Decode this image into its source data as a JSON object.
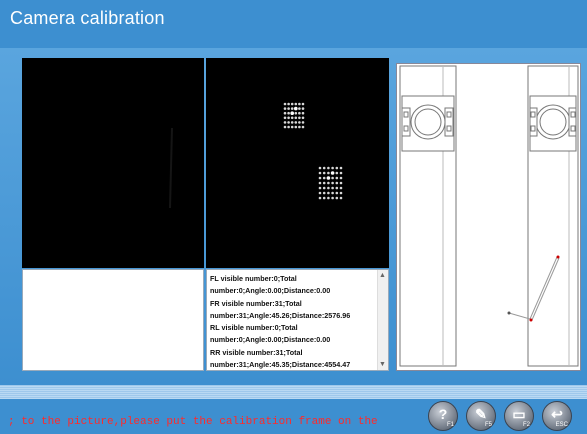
{
  "window": {
    "title": "Camera calibration"
  },
  "info": {
    "lines": [
      "FL visible number:0;Total",
      "number:0;Angle:0.00;Distance:0.00",
      "FR visible number:31;Total",
      "number:31;Angle:45.26;Distance:2576.96",
      "RL visible number:0;Total",
      "number:0;Angle:0.00;Distance:0.00",
      "RR visible number:31;Total",
      "number:31;Angle:45.35;Distance:4554.47"
    ]
  },
  "status": {
    "message": "; to the picture,please put the calibration frame on the"
  },
  "buttons": [
    {
      "icon": "help-icon",
      "key": "F1"
    },
    {
      "icon": "settings-icon",
      "key": "F5"
    },
    {
      "icon": "car-icon",
      "key": "F2"
    },
    {
      "icon": "exit-icon",
      "key": "ESC"
    }
  ],
  "colors": {
    "background": "#3d8fd0",
    "message": "#ff2a2a",
    "camera_bg": "#000000"
  }
}
